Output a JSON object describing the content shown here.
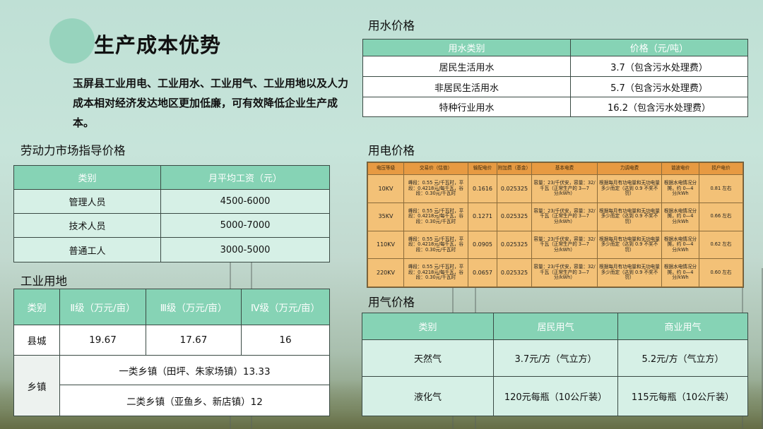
{
  "title": "生产成本优势",
  "intro": "玉屏县工业用电、工业用水、工业用气、工业用地以及人力成本相对经济发达地区更加低廉，可有效降低企业生产成本。",
  "labor": {
    "title": "劳动力市场指导价格",
    "headers": [
      "类别",
      "月平均工资（元）"
    ],
    "rows": [
      [
        "管理人员",
        "4500-6000"
      ],
      [
        "技术人员",
        "5000-7000"
      ],
      [
        "普通工人",
        "3000-5000"
      ]
    ]
  },
  "land": {
    "title": "工业用地",
    "headers": [
      "类别",
      "Ⅱ级（万元/亩）",
      "Ⅲ级（万元/亩）",
      "Ⅳ级（万元/亩）"
    ],
    "county": {
      "label": "县城",
      "values": [
        "19.67",
        "17.67",
        "16"
      ]
    },
    "town": {
      "label": "乡镇",
      "lines": [
        "一类乡镇（田坪、朱家场镇）13.33",
        "二类乡镇（亚鱼乡、新店镇）12"
      ]
    }
  },
  "water": {
    "title": "用水价格",
    "headers": [
      "用水类别",
      "价格（元/吨）"
    ],
    "rows": [
      [
        "居民生活用水",
        "3.7（包含污水处理费）"
      ],
      [
        "非居民生活用水",
        "5.7（包含污水处理费）"
      ],
      [
        "特种行业用水",
        "16.2（包含污水处理费）"
      ]
    ]
  },
  "electricity": {
    "title": "用电价格",
    "headers": [
      "电压等级",
      "交易价（估值）",
      "输配电价",
      "附加费（基金）",
      "基本电费",
      "力调电费",
      "谐波电价",
      "损户电价"
    ],
    "rows": [
      [
        "10KV",
        "峰段：0.55 元/千瓦时，平段：0.4218元/每千瓦，谷段：0.30元/千瓦时",
        "0.1616",
        "0.025325",
        "容量：23/千伏安，容量：32/千瓦（正常生产的 3—7 分/kWh）",
        "根据每月有功电量和无功电量多少而定（达到 0.9 不奖不罚）",
        "根据水电情况分摊，约 0—4 分/kWh",
        "0.81 左右"
      ],
      [
        "35KV",
        "峰段：0.55 元/千瓦时，平段：0.4218元/每千瓦，谷段：0.30元/千瓦时",
        "0.1271",
        "0.025325",
        "容量：23/千伏安，容量：32/千瓦（正常生产的 3—7 分/kWh）",
        "根据每月有功电量和无功电量多少而定（达到 0.9 不奖不罚）",
        "根据水电情况分摊，约 0—4 分/kWh",
        "0.66 左右"
      ],
      [
        "110KV",
        "峰段：0.55 元/千瓦时，平段：0.4218元/每千瓦，谷段：0.30元/千瓦时",
        "0.0905",
        "0.025325",
        "容量：23/千伏安，容量：32/千瓦（正常生产的 3—7 分/kWh）",
        "根据每月有功电量和无功电量多少而定（达到 0.9 不奖不罚）",
        "根据水电情况分摊，约 0—4 分/kWh",
        "0.62 左右"
      ],
      [
        "220KV",
        "峰段：0.55 元/千瓦时，平段：0.4218元/每千瓦，谷段：0.30元/千瓦时",
        "0.0657",
        "0.025325",
        "容量：23/千伏安，容量：32/千瓦（正常生产的 3—7 分/kWh）",
        "根据每月有功电量和无功电量多少而定（达到 0.9 不奖不罚）",
        "根据水电情况分摊，约 0—4 分/kWh",
        "0.60 左右"
      ]
    ]
  },
  "gas": {
    "title": "用气价格",
    "headers": [
      "类别",
      "居民用气",
      "商业用气"
    ],
    "rows": [
      [
        "天然气",
        "3.7元/方（气立方）",
        "5.2元/方（气立方）"
      ],
      [
        "液化气",
        "120元每瓶（10公斤装）",
        "115元每瓶（10公斤装）"
      ]
    ]
  },
  "colors": {
    "accent": "#86d3b5",
    "cell": "#d6f0e6",
    "elec_header": "#e79a42",
    "elec_body": "#f3c177"
  }
}
